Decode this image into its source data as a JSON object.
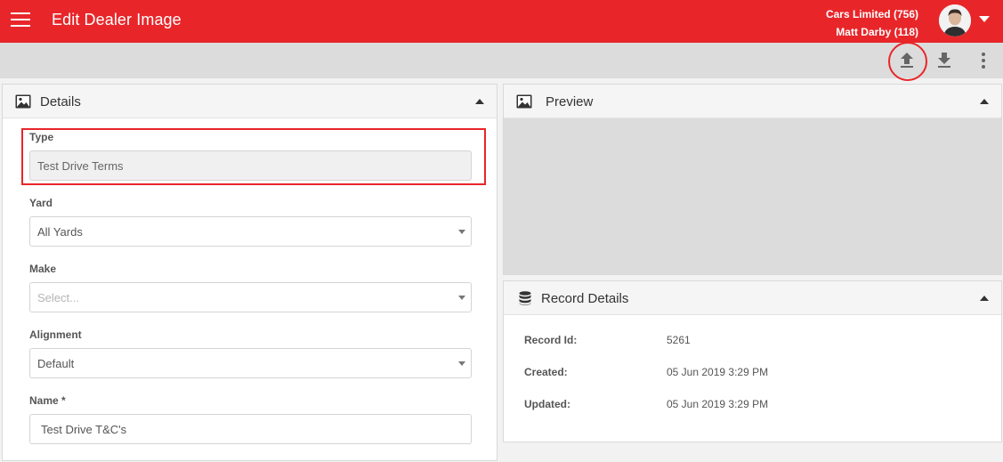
{
  "header": {
    "title": "Edit Dealer Image",
    "company": "Cars Limited (756)",
    "user": "Matt Darby (118)",
    "accent_color": "#e8262a"
  },
  "toolbar": {
    "icons": [
      "upload-icon",
      "download-icon",
      "more-vertical-icon"
    ]
  },
  "details": {
    "title": "Details",
    "icon": "image-icon",
    "fields": {
      "type": {
        "label": "Type",
        "value": "Test Drive Terms"
      },
      "yard": {
        "label": "Yard",
        "value": "All Yards"
      },
      "make": {
        "label": "Make",
        "placeholder": "Select..."
      },
      "alignment": {
        "label": "Alignment",
        "value": "Default"
      },
      "name": {
        "label": "Name *",
        "value": "Test Drive T&C's"
      }
    }
  },
  "preview": {
    "title": "Preview",
    "icon": "image-icon"
  },
  "record": {
    "title": "Record Details",
    "icon": "database-icon",
    "rows": [
      {
        "label": "Record Id:",
        "value": "5261"
      },
      {
        "label": "Created:",
        "value": "05 Jun 2019 3:29 PM"
      },
      {
        "label": "Updated:",
        "value": "05 Jun 2019 3:29 PM"
      }
    ]
  }
}
